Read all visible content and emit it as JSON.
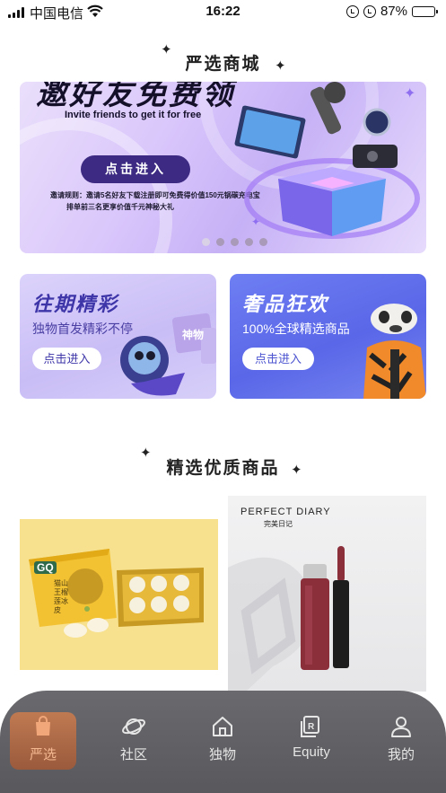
{
  "status_bar": {
    "carrier": "中国电信",
    "time": "16:22",
    "battery": "87%",
    "battery_level": 0.87
  },
  "section1": {
    "title": "严选商城"
  },
  "hero_banner": {
    "headline": "邀好友免费领",
    "subline": "Invite friends to get it for free",
    "cta_label": "点击进入",
    "rules_line1": "邀请规则：邀请5名好友下载注册即可免费得价值150元锅碳充电宝",
    "rules_line2": "排单前三名更享价值千元神秘大礼",
    "carousel_count": 5,
    "carousel_active": 0
  },
  "promo_cards": [
    {
      "title": "往期精彩",
      "subtitle": "独物首发精彩不停",
      "button": "点击进入",
      "tag": "神物"
    },
    {
      "title": "奢品狂欢",
      "subtitle": "100%全球精选商品",
      "button": "点击进入"
    }
  ],
  "section2": {
    "title": "精选优质商品"
  },
  "products": [
    {
      "brand": "GQ",
      "pack_name": "猫山王榴莲冰皮"
    },
    {
      "brand": "PERFECT DIARY",
      "brand_cn": "完美日记"
    }
  ],
  "tab_bar": {
    "items": [
      {
        "label": "严选",
        "icon": "bag-icon",
        "active": true
      },
      {
        "label": "社区",
        "icon": "planet-icon",
        "active": false
      },
      {
        "label": "独物",
        "icon": "home-icon",
        "active": false
      },
      {
        "label": "Equity",
        "icon": "equity-icon",
        "active": false
      },
      {
        "label": "我的",
        "icon": "user-icon",
        "active": false
      }
    ]
  },
  "colors": {
    "tab_bar_bg": "#5f5f63",
    "tab_active": "#b06d4b",
    "hero_bg": "#d9c6fb",
    "cta_bg": "#3d2a82",
    "promo_right_bg": "#5a67e8"
  }
}
